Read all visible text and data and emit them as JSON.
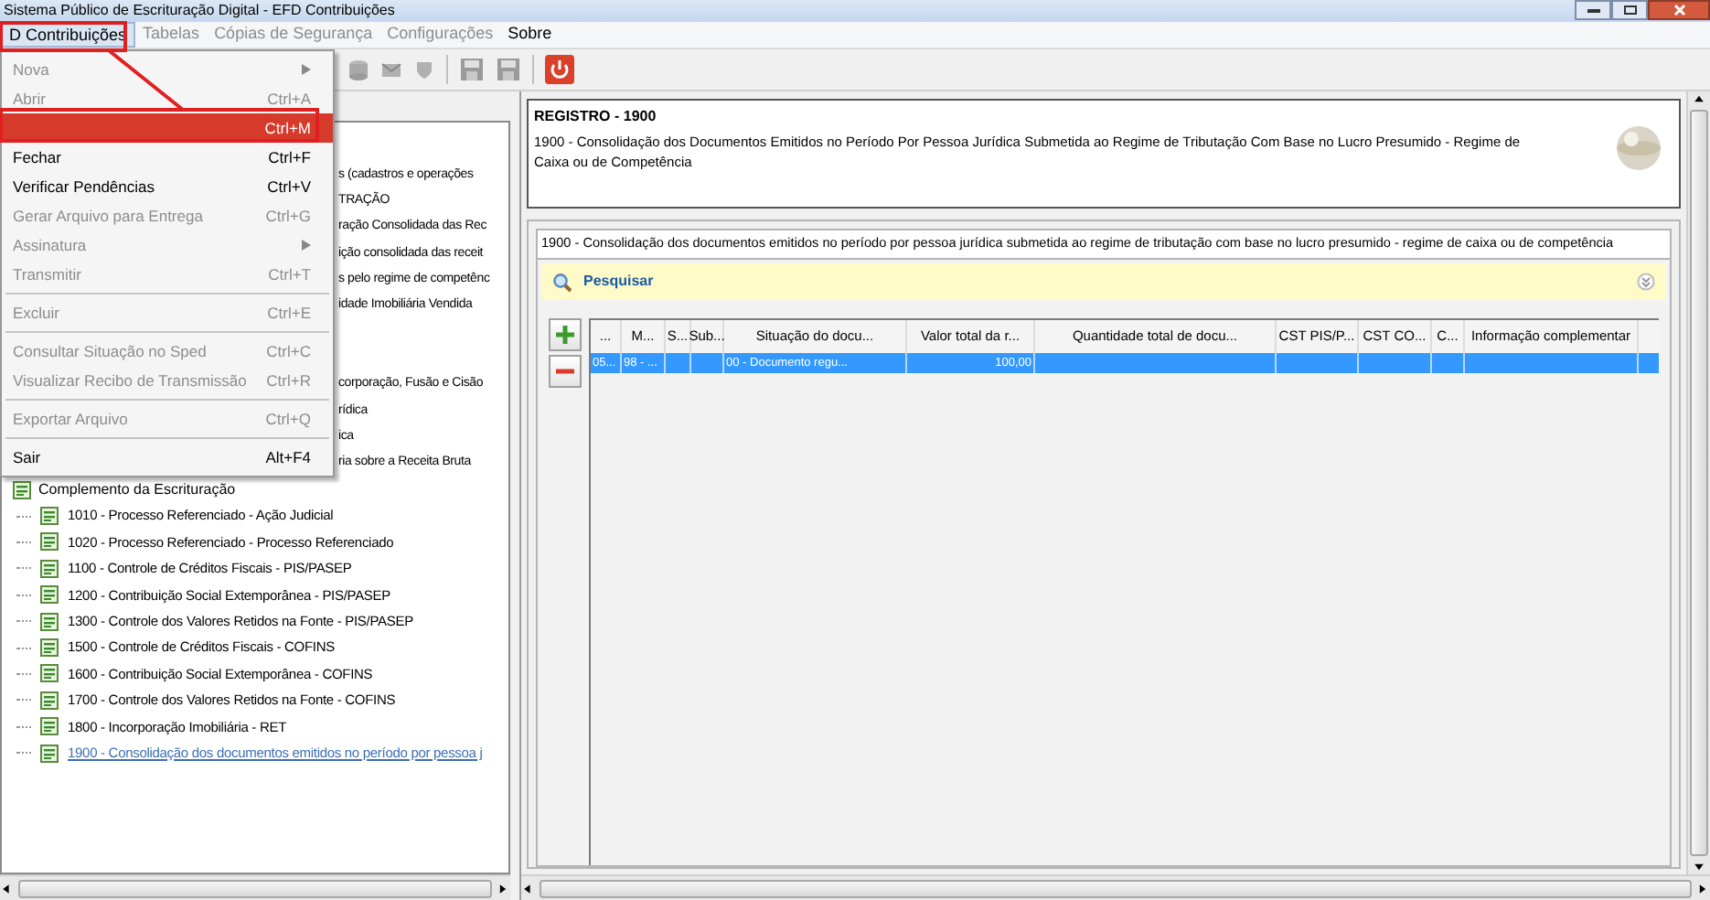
{
  "window": {
    "title": "Sistema Público de Escrituração Digital - EFD Contribuições"
  },
  "menu_bar": [
    {
      "label": "D Contribuições",
      "selected": true,
      "disabled": false
    },
    {
      "label": "Tabelas",
      "selected": false,
      "disabled": true
    },
    {
      "label": "Cópias de Segurança",
      "selected": false,
      "disabled": true
    },
    {
      "label": "Configurações",
      "selected": false,
      "disabled": true
    },
    {
      "label": "Sobre",
      "selected": false,
      "disabled": false
    }
  ],
  "menu": [
    {
      "label": "Nova",
      "submenu": true,
      "disabled": true,
      "selected": false
    },
    {
      "label": "Abrir",
      "shortcut": "Ctrl+A",
      "disabled": true,
      "selected": false
    },
    {
      "shortcut": "Ctrl+M",
      "disabled": false,
      "selected": true
    },
    {
      "label": "Fechar",
      "shortcut": "Ctrl+F",
      "disabled": false,
      "selected": false
    },
    {
      "label": "Verificar Pendências",
      "shortcut": "Ctrl+V",
      "disabled": false,
      "selected": false
    },
    {
      "label": "Gerar Arquivo para Entrega",
      "shortcut": "Ctrl+G",
      "disabled": true,
      "selected": false
    },
    {
      "label": "Assinatura",
      "submenu": true,
      "disabled": true,
      "selected": false
    },
    {
      "label": "Transmitir",
      "shortcut": "Ctrl+T",
      "disabled": true,
      "selected": false,
      "separator_after": true
    },
    {
      "label": "Excluir",
      "shortcut": "Ctrl+E",
      "disabled": true,
      "selected": false,
      "separator_after": true
    },
    {
      "label": "Consultar Situação no Sped",
      "shortcut": "Ctrl+C",
      "disabled": true,
      "selected": false
    },
    {
      "label": "Visualizar Recibo de Transmissão",
      "shortcut": "Ctrl+R",
      "disabled": true,
      "selected": false,
      "separator_after": true
    },
    {
      "label": "Exportar Arquivo",
      "shortcut": "Ctrl+Q",
      "disabled": true,
      "selected": false,
      "separator_after": true
    },
    {
      "label": "Sair",
      "shortcut": "Alt+F4",
      "disabled": false,
      "selected": false
    }
  ],
  "tree": {
    "partial_rows": [
      "s (cadastros e operações",
      "TRAÇÃO",
      "ração Consolidada das Rec",
      "ição consolidada das receit",
      "s pelo regime de competênc",
      "idade Imobiliária Vendida",
      null,
      null,
      "corporação, Fusão e Cisão",
      "rídica",
      "ica",
      "ria sobre a Receita Bruta"
    ],
    "node": {
      "label": "Complemento da Escrituração",
      "expanded": true,
      "children": [
        {
          "label": "1010 - Processo Referenciado - Ação Judicial",
          "selected": false
        },
        {
          "label": "1020 - Processo Referenciado - Processo Referenciado",
          "selected": false
        },
        {
          "label": "1100 - Controle de Créditos Fiscais - PIS/PASEP",
          "selected": false
        },
        {
          "label": "1200 - Contribuição Social Extemporânea - PIS/PASEP",
          "selected": false
        },
        {
          "label": "1300 - Controle dos Valores Retidos na Fonte - PIS/PASEP",
          "selected": false
        },
        {
          "label": "1500 - Controle de Créditos Fiscais - COFINS",
          "selected": false
        },
        {
          "label": "1600 - Contribuição Social Extemporânea - COFINS",
          "selected": false
        },
        {
          "label": "1700 - Controle dos Valores Retidos na Fonte - COFINS",
          "selected": false
        },
        {
          "label": "1800 - Incorporação Imobiliária - RET",
          "selected": false
        },
        {
          "label": "1900 - Consolidação dos documentos emitidos no período por pessoa j",
          "selected": true
        }
      ]
    }
  },
  "header": {
    "title": "REGISTRO - 1900",
    "description": "1900 - Consolidação dos Documentos Emitidos no Período Por Pessoa Jurídica Submetida ao Regime de Tributação Com Base no Lucro Presumido - Regime de Caixa ou de Competência"
  },
  "tab": {
    "label": "1900 - Consolidação dos documentos emitidos no período por pessoa jurídica submetida ao regime de tributação com base no lucro presumido - regime de caixa ou de competência",
    "selected": true
  },
  "search_bar": {
    "label": "Pesquisar"
  },
  "table": {
    "columns": [
      "...",
      "M...",
      "S...",
      "Sub...",
      "Situação do docu...",
      "Valor total da r...",
      "Quantidade total de docu...",
      "CST PIS/P...",
      "CST CO...",
      "C...",
      "Informação complementar"
    ],
    "rows": [
      {
        "selected": true,
        "cells": [
          "05...",
          "98 - ...",
          null,
          null,
          "00 - Documento regu...",
          "100,00",
          null,
          null,
          null,
          null,
          null
        ]
      }
    ]
  }
}
